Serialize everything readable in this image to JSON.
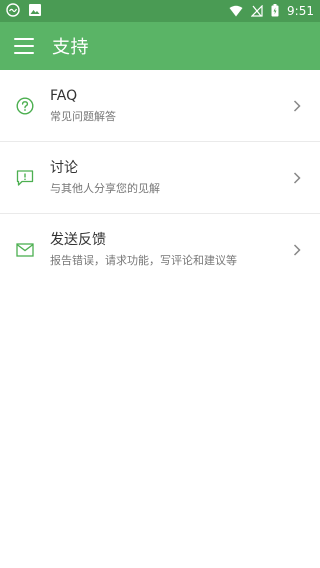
{
  "status_bar": {
    "time": "9:51"
  },
  "app_bar": {
    "title": "支持"
  },
  "items": [
    {
      "title": "FAQ",
      "subtitle": "常见问题解答",
      "icon": "help-circle-icon"
    },
    {
      "title": "讨论",
      "subtitle": "与其他人分享您的见解",
      "icon": "feedback-icon"
    },
    {
      "title": "发送反馈",
      "subtitle": "报告错误，请求功能，写评论和建议等",
      "icon": "mail-icon"
    }
  ],
  "colors": {
    "status_bar": "#4a9b54",
    "app_bar": "#5ab466",
    "icon_green": "#4caf50"
  }
}
